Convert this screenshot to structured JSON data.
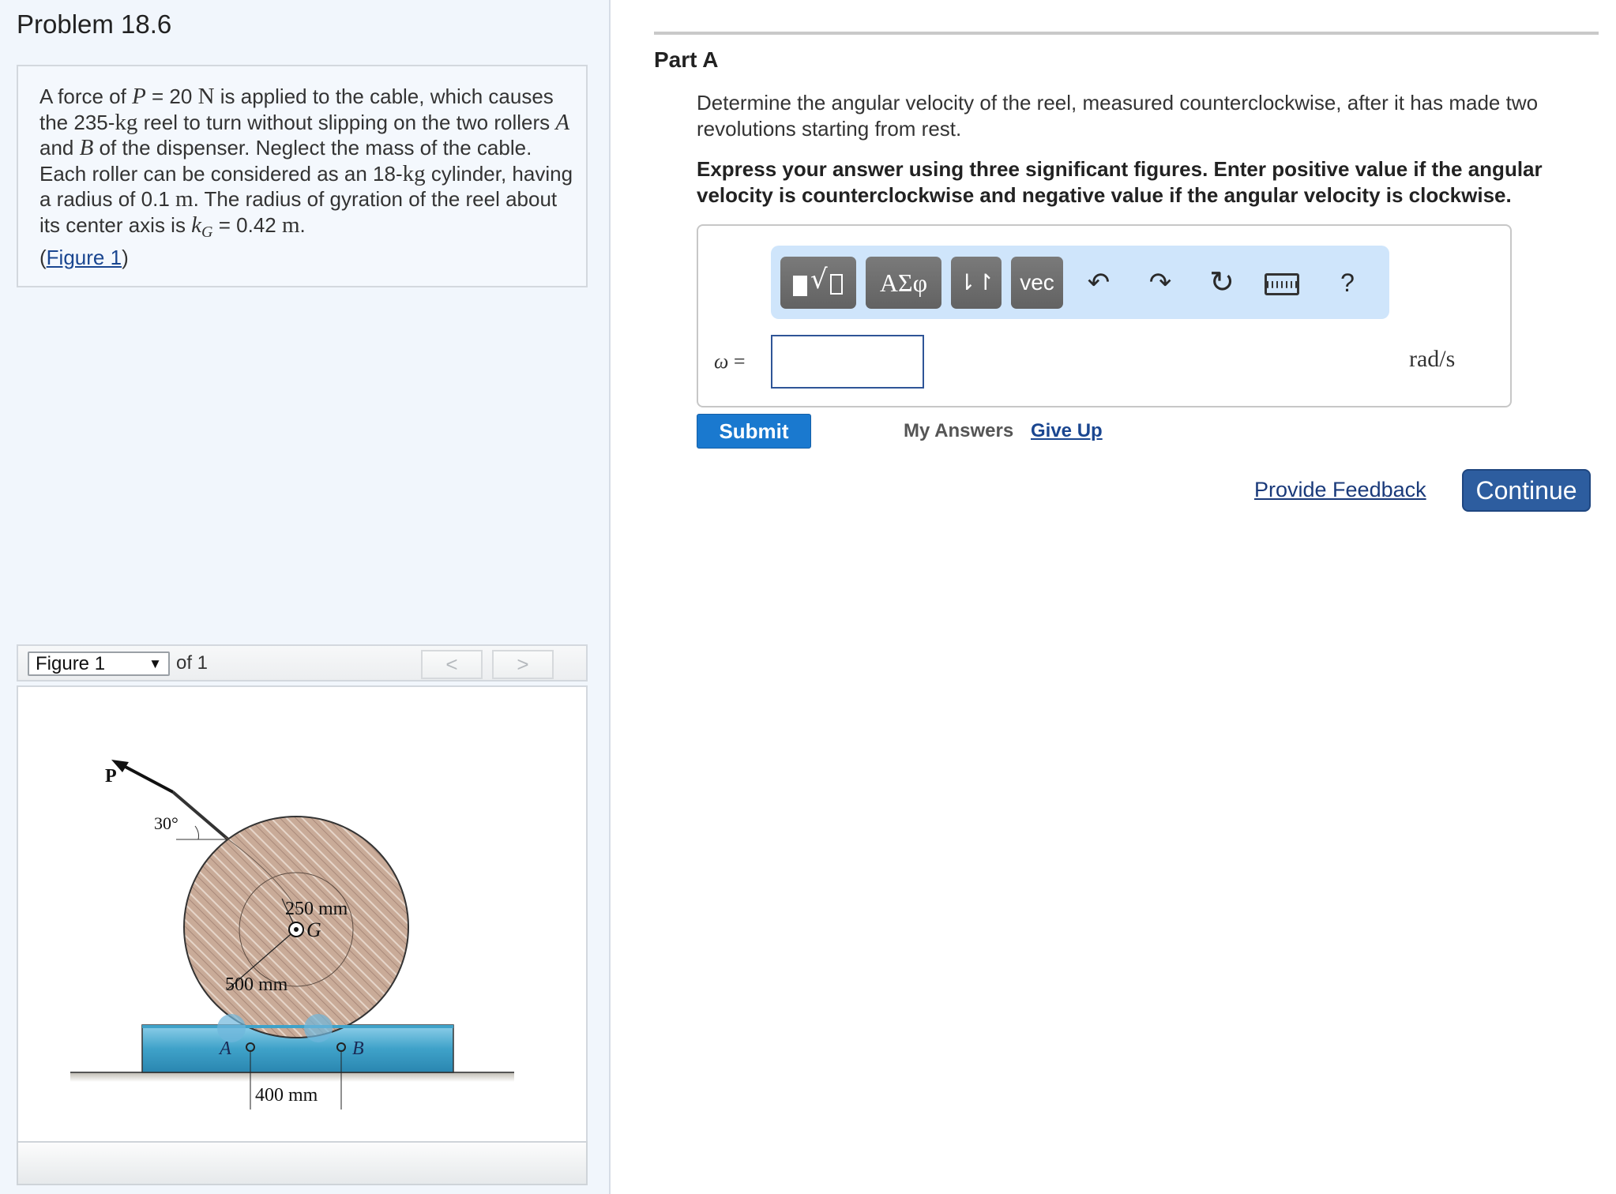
{
  "problem": {
    "title": "Problem 18.6",
    "text_parts": {
      "p1": "A force of ",
      "P": "P",
      "p2": " = 20 ",
      "N": "N",
      "p3": " is applied to the cable, which causes the 235-",
      "kg1": "kg",
      "p4": " reel to turn without slipping on the two rollers ",
      "A": "A",
      "p5": " and ",
      "B": "B",
      "p6": " of the dispenser. Neglect the mass of the cable. Each roller can be considered as an 18-",
      "kg2": "kg",
      "p7": " cylinder, having a radius of 0.1 ",
      "m1": "m",
      "p8": ". The radius of gyration of the reel about its center axis is ",
      "kG": "k",
      "kG_sub": "G",
      "p9": " = 0.42 ",
      "m2": "m",
      "p10": "."
    },
    "figure_link_open": "(",
    "figure_link": "Figure 1",
    "figure_link_close": ")"
  },
  "figure_viewer": {
    "selected": "Figure 1",
    "of_label": "of 1",
    "prev_label": "<",
    "next_label": ">"
  },
  "figure": {
    "force_label": "P",
    "angle_label": "30°",
    "inner_radius_label": "250 mm",
    "center_label": "G",
    "outer_radius_label": "500 mm",
    "roller_a_label": "A",
    "roller_b_label": "B",
    "spacing_label": "400 mm",
    "colors": {
      "reel": "#c9ab98",
      "dispenser": "#3fa2c9",
      "ground": "#555555"
    }
  },
  "part": {
    "title": "Part A",
    "description": "Determine the angular velocity of the reel, measured counterclockwise, after it has made two revolutions starting from rest.",
    "instructions": "Express your answer using three significant figures. Enter positive value if the angular velocity is counterclockwise and negative value if the angular velocity is clockwise."
  },
  "toolbar": {
    "templates_icon": "template-sqrt-icon",
    "greek_label": "ΑΣφ",
    "arrows_label": "⇂↾",
    "vec_label": "vec",
    "undo_icon": "undo-icon",
    "redo_icon": "redo-icon",
    "reset_icon": "reset-icon",
    "keyboard_icon": "keyboard-icon",
    "help_label": "?"
  },
  "answer": {
    "variable": "ω",
    "equals": "=",
    "value": "",
    "unit": "rad/s"
  },
  "actions": {
    "submit": "Submit",
    "my_answers": "My Answers",
    "give_up": "Give Up",
    "provide_feedback": "Provide Feedback",
    "continue": "Continue"
  },
  "colors": {
    "submit_bg": "#1a79cf",
    "continue_bg": "#2d5d9f",
    "toolbar_bg": "#cfe5fb",
    "link": "#1a4690"
  }
}
